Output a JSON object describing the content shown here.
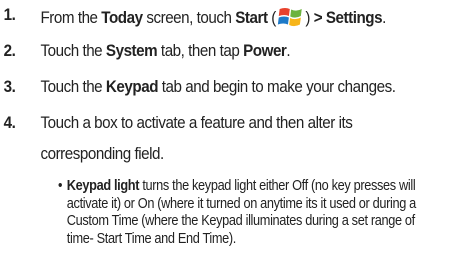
{
  "steps": [
    {
      "num": "1.",
      "pre": "From the ",
      "bold1": "Today",
      "mid": " screen, touch ",
      "bold2": "Start",
      "paren_open": " (",
      "icon": "windows-start-icon",
      "paren_close": ")",
      "bold3": " > Settings",
      "end": "."
    },
    {
      "num": "2.",
      "pre": "Touch the ",
      "bold1": "System",
      "mid": " tab, then tap ",
      "bold2": "Power",
      "end": "."
    },
    {
      "num": "3.",
      "pre": "Touch the ",
      "bold1": "Keypad",
      "end": " tab and begin to make your changes."
    },
    {
      "num": "4.",
      "line1": "Touch a box to activate a feature and then alter its",
      "line2": "corresponding field."
    }
  ],
  "bullet": {
    "dot": "•",
    "term": "Keypad light",
    "line1_rest": " turns the keypad light either Off (no key presses will",
    "line2": "activate it) or On (where it turned on anytime its it used or during a",
    "line3": "Custom Time (where the Keypad illuminates during a set range of",
    "line4": "time- Start Time and End Time)."
  },
  "colors": {
    "text": "#222222",
    "logo_red": "#e8412c",
    "logo_green": "#6cb33f",
    "logo_blue": "#1e7ac8",
    "logo_yellow": "#f7b51a"
  }
}
